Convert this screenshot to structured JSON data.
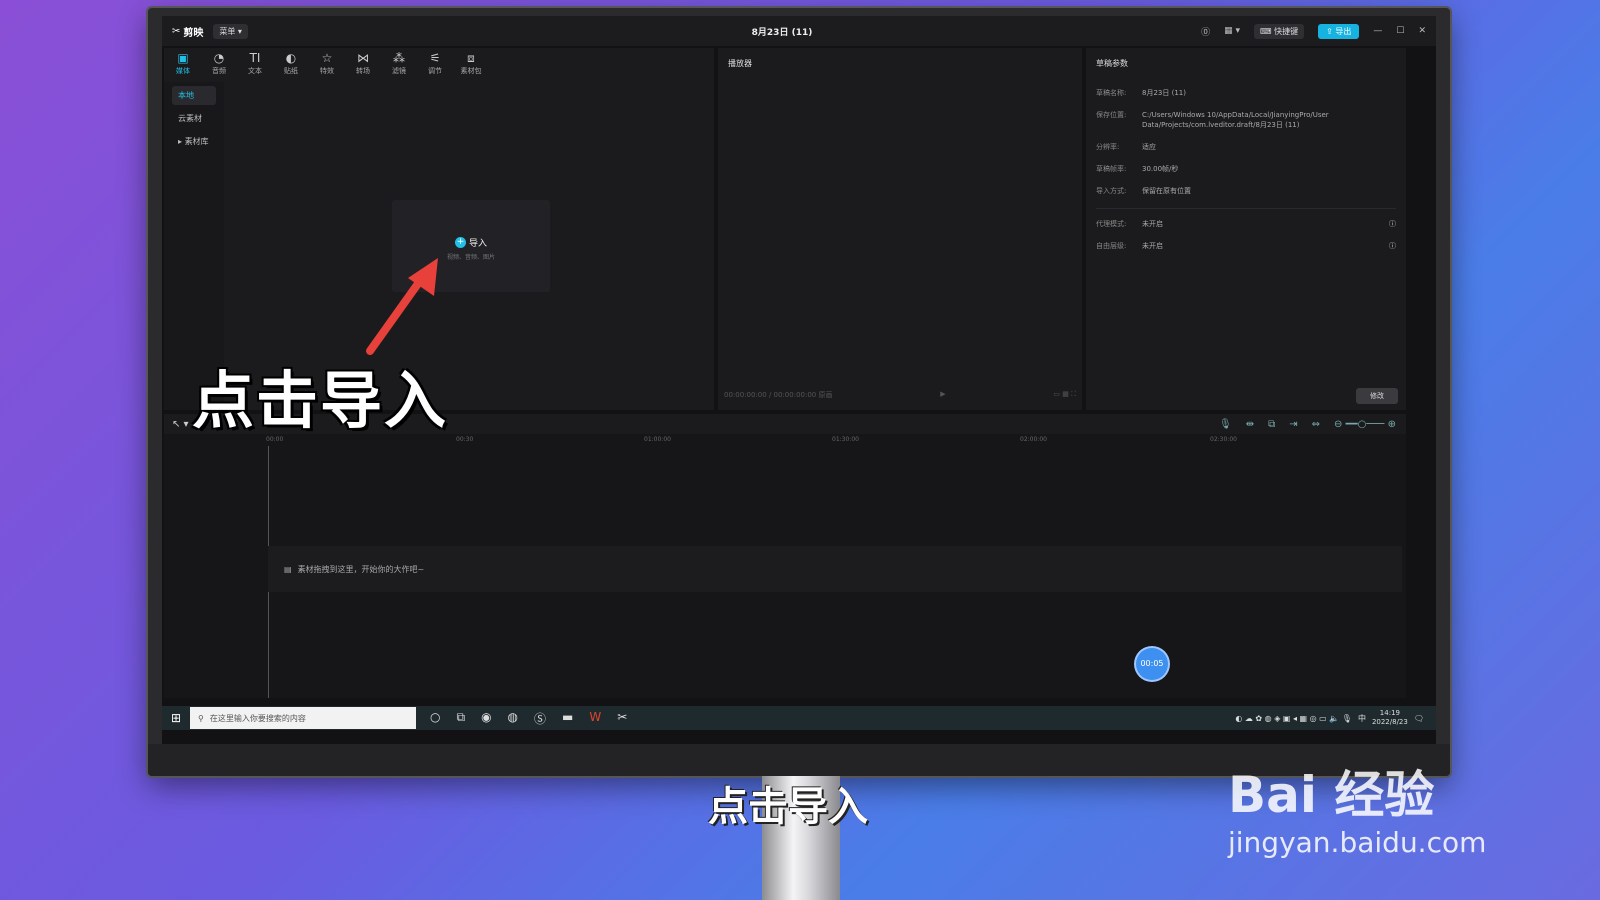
{
  "app": {
    "logo_text": "剪映",
    "menu_label": "菜单",
    "title": "8月23日 (11)",
    "shortcut_label": "快捷键",
    "export_label": "导出"
  },
  "toolbar": {
    "tools": [
      "媒体",
      "音频",
      "文本",
      "贴纸",
      "特效",
      "转场",
      "滤镜",
      "调节",
      "素材包"
    ]
  },
  "media": {
    "side": [
      "本地",
      "云素材",
      "素材库"
    ],
    "import_label": "导入",
    "import_sub": "视频、音频、图片"
  },
  "player": {
    "title": "播放器",
    "time_current": "00:00:00:00",
    "time_total": "00:00:00:00",
    "quality": "原画"
  },
  "props": {
    "title": "草稿参数",
    "rows": [
      {
        "label": "草稿名称:",
        "value": "8月23日 (11)"
      },
      {
        "label": "保存位置:",
        "value": "C:/Users/Windows 10/AppData/Local/JianyingPro/User Data/Projects/com.lveditor.draft/8月23日 (11)"
      },
      {
        "label": "分辨率:",
        "value": "适应"
      },
      {
        "label": "草稿帧率:",
        "value": "30.00帧/秒"
      },
      {
        "label": "导入方式:",
        "value": "保留在原有位置"
      },
      {
        "label": "代理模式:",
        "value": "未开启"
      },
      {
        "label": "自由层级:",
        "value": "未开启"
      }
    ],
    "modify_label": "修改"
  },
  "timeline": {
    "ticks": [
      "00:00",
      "00:30",
      "01:00:00",
      "01:30:00",
      "02:00:00",
      "02:30:00"
    ],
    "hint": "素材拖拽到这里，开始你的大作吧~",
    "bubble": "00:05"
  },
  "taskbar": {
    "search_placeholder": "在这里输入你要搜索的内容",
    "time": "14:19",
    "date": "2022/8/23",
    "lang": "中"
  },
  "overlay": {
    "big_caption": "点击导入",
    "subtitle": "点击导入",
    "watermark_logo": "Bai 经验",
    "watermark_url": "jingyan.baidu.com"
  }
}
